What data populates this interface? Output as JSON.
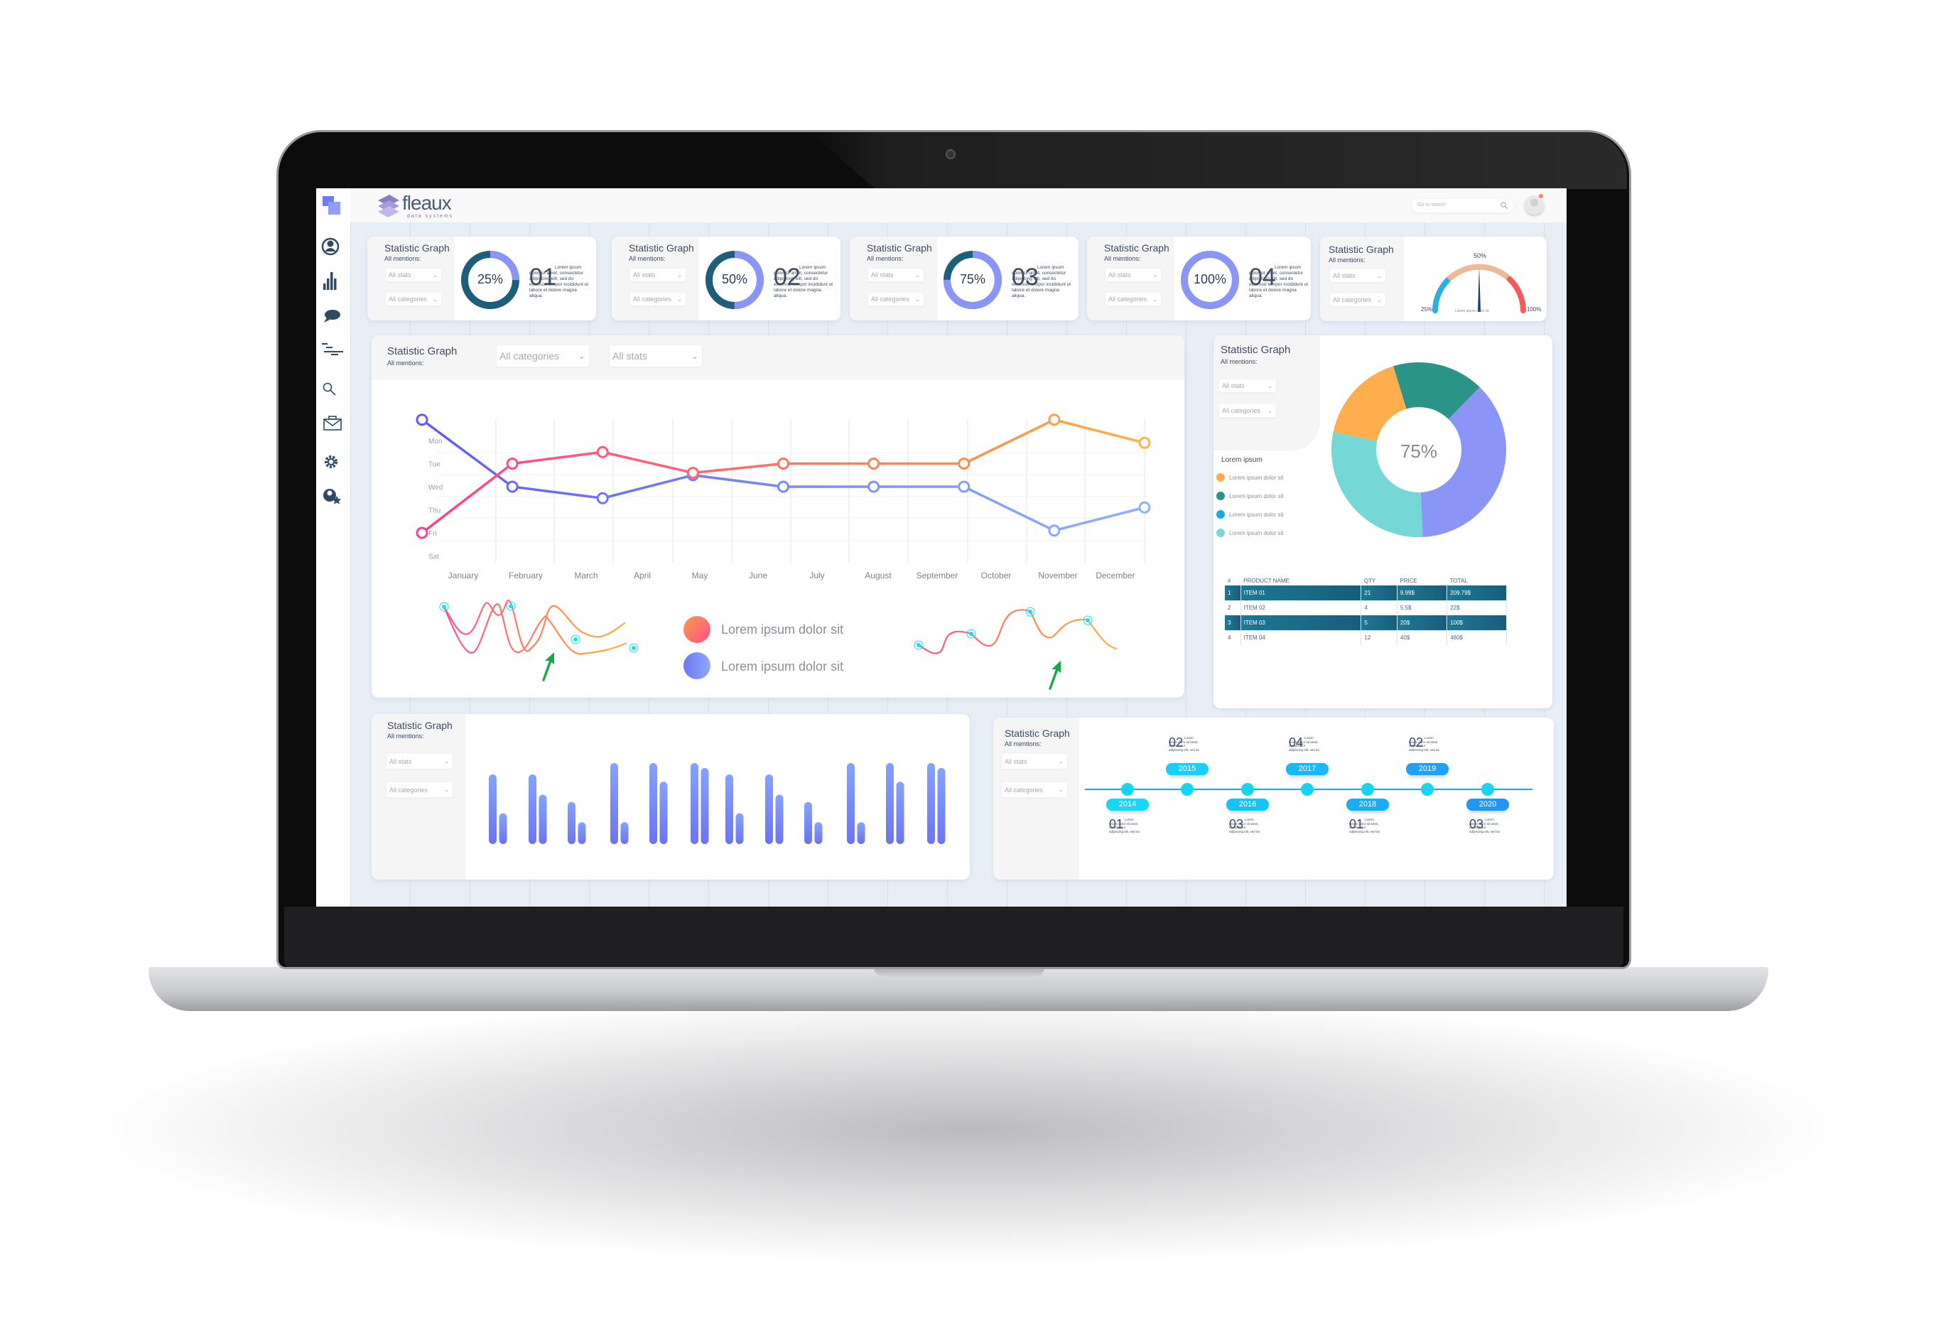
{
  "brand": {
    "name": "fleaux",
    "tagline": "data systems"
  },
  "header": {
    "search_placeholder": "Go to search"
  },
  "sidebar": {
    "items": [
      "user-icon",
      "bar-chart-icon",
      "chat-icon",
      "gantt-icon",
      "search-icon",
      "briefcase-icon",
      "gear-icon",
      "user-star-icon"
    ]
  },
  "common": {
    "title": "Statistic Graph",
    "subtitle": "All mentions:",
    "all_stats": "All stats",
    "all_categories": "All categories"
  },
  "top_cards": [
    {
      "percent": "25%",
      "progress": 25,
      "number": "01",
      "text": "Lorem ipsum dolor sit amet, consectetur adipiscing elit, sed do eiusmod tempor incididunt ut labore et dolore magna aliqua."
    },
    {
      "percent": "50%",
      "progress": 50,
      "number": "02",
      "text": "Lorem ipsum dolor sit amet, consectetur adipiscing elit, sed do eiusmod tempor incididunt ut labore et dolore magna aliqua."
    },
    {
      "percent": "75%",
      "progress": 75,
      "number": "03",
      "text": "Lorem ipsum dolor sit amet, consectetur adipiscing elit, sed do eiusmod tempor incididunt ut labore et dolore magna aliqua."
    },
    {
      "percent": "100%",
      "progress": 100,
      "number": "04",
      "text": "Lorem ipsum dolor sit amet, consectetur adipiscing elit, sed do eiusmod tempor incididunt ut labore et dolore magna aliqua."
    }
  ],
  "gauge": {
    "label_min": "25%",
    "label_mid": "50%",
    "label_max": "100%",
    "caption": "Lorem ipsum  dolor sit",
    "value": 50
  },
  "legend_main": [
    "Lorem ipsum dolor sit",
    "Lorem ipsum dolor sit"
  ],
  "pie_legend": {
    "title": "Lorem ipsum",
    "items": [
      "Lorem ipsum  dolor sit",
      "Lorem ipsum  dolor sit",
      "Lorem ipsum  dolor sit",
      "Lorem ipsum  dolor sit"
    ]
  },
  "table": {
    "headers": [
      "#",
      "PRODUCT NAME",
      "QTY",
      "PRICE",
      "TOTAL"
    ],
    "rows": [
      [
        "1",
        "ITEM 01",
        "21",
        "9.99$",
        "209.79$"
      ],
      [
        "2",
        "ITEM 02",
        "4",
        "5.5$",
        "22$"
      ],
      [
        "3",
        "ITEM 03",
        "5",
        "20$",
        "100$"
      ],
      [
        "4",
        "ITEM 04",
        "12",
        "40$",
        "480$"
      ]
    ]
  },
  "timeline": [
    {
      "year": "2014",
      "number": "01",
      "text": "Lorem ipsum dolor sit amet, consectetur adipiscing elit, sed do"
    },
    {
      "year": "2015",
      "number": "02",
      "text": "Lorem ipsum dolor sit amet, consectetur adipiscing elit, sed do"
    },
    {
      "year": "2016",
      "number": "03",
      "text": "Lorem ipsum dolor sit amet, consectetur adipiscing elit, sed do"
    },
    {
      "year": "2017",
      "number": "04",
      "text": "Lorem ipsum dolor sit amet, consectetur adipiscing elit, sed do"
    },
    {
      "year": "2018",
      "number": "01",
      "text": "Lorem ipsum dolor sit amet, consectetur adipiscing elit, sed do"
    },
    {
      "year": "2019",
      "number": "02",
      "text": "Lorem ipsum dolor sit amet, consectetur adipiscing elit, sed do"
    },
    {
      "year": "2020",
      "number": "03",
      "text": "Lorem ipsum dolor sit amet, consectetur adipiscing elit, sed do"
    }
  ],
  "colors": {
    "accent": "#7b86f5",
    "teal": "#1d5f7a",
    "orange": "#ffad4d",
    "pink": "#ff4f8b",
    "cyan": "#15d8f5"
  },
  "chart_data": [
    {
      "type": "line",
      "xlabels": [
        "January",
        "February",
        "March",
        "April",
        "May",
        "June",
        "July",
        "August",
        "September",
        "October",
        "November",
        "December"
      ],
      "ylabels": [
        "Mon",
        "Tue",
        "Wed",
        "Thu",
        "Fri",
        "Sat"
      ],
      "points_x": [
        "January",
        "February",
        "March",
        "May",
        "June",
        "August",
        "September",
        "November",
        "December"
      ],
      "series": [
        {
          "color": "#6c6cf0",
          "values": [
            0.1,
            3.0,
            3.5,
            2.5,
            3.0,
            3.0,
            3.0,
            4.9,
            3.9
          ]
        },
        {
          "color": "#ff4f8b",
          "values": [
            5.0,
            2.0,
            1.5,
            2.4,
            2.0,
            2.0,
            2.0,
            0.1,
            1.1
          ]
        }
      ],
      "grid": true
    },
    {
      "type": "pie",
      "center_label": "75%",
      "values": [
        17,
        37,
        29,
        17
      ],
      "colors": [
        "#2a9489",
        "#8b95f8",
        "#76d8d6",
        "#ffad4d"
      ]
    },
    {
      "type": "bar",
      "series": [
        {
          "values": [
            86,
            86,
            52,
            100,
            100,
            100,
            86,
            86,
            52,
            100,
            100,
            100
          ]
        },
        {
          "values": [
            38,
            61,
            27,
            27,
            77,
            94,
            38,
            61,
            27,
            27,
            77,
            94
          ]
        }
      ],
      "ylim": [
        0,
        100
      ],
      "color": "#7b86f5"
    }
  ]
}
